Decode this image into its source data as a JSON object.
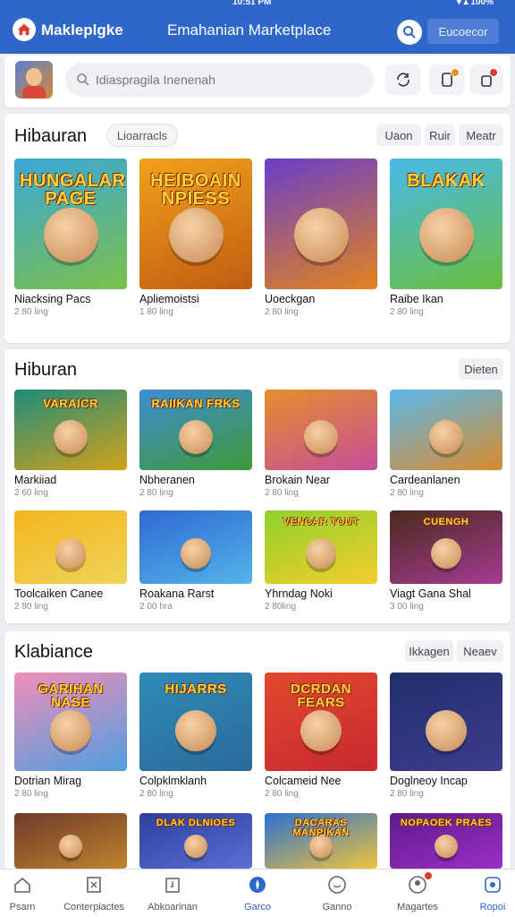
{
  "statusbar": {
    "time": "10:51 PM",
    "status": "▾ ▴ 100%"
  },
  "header": {
    "brand": "Makleplgke",
    "title": "Emahanian Marketplace",
    "action_label": "Eucoecor"
  },
  "search": {
    "placeholder": "Idiaspragila Inenenah"
  },
  "sections": [
    {
      "title": "Hibauran",
      "chip": "Lioarracls",
      "pills": [
        "Uaon",
        "Ruir",
        "Meatr"
      ],
      "items": [
        {
          "name": "Niacksing Pacs",
          "meta": "2 80 ling",
          "art": "HUNGALAR PAGE",
          "bg": [
            "#3aa7d8",
            "#7cc04a"
          ],
          "icon": "game-art"
        },
        {
          "name": "Apliemoistsi",
          "meta": "1 80 ling",
          "art": "HEIBOAIN NPIESS",
          "bg": [
            "#f0a21a",
            "#c25b12"
          ],
          "icon": "game-art"
        },
        {
          "name": "Uoeckgan",
          "meta": "2 80 ling",
          "art": "",
          "bg": [
            "#6a3ec9",
            "#e2831f"
          ],
          "icon": "game-art"
        },
        {
          "name": "Raibe Ikan",
          "meta": "2 80 ling",
          "art": "BLAKAK",
          "bg": [
            "#47b9e8",
            "#6bbf3e"
          ],
          "icon": "game-art"
        }
      ]
    },
    {
      "title": "Hiburan",
      "pills": [
        "Dieten"
      ],
      "items": [
        {
          "name": "Markiiad",
          "meta": "2 60 ling",
          "art": "VARAICR",
          "bg": [
            "#1e8c7a",
            "#d3a21c"
          ],
          "icon": "game-art"
        },
        {
          "name": "Nbheranen",
          "meta": "2 80 ling",
          "art": "RAIIKAN FRKS",
          "bg": [
            "#3d8bd5",
            "#3f9a36"
          ],
          "icon": "game-art"
        },
        {
          "name": "Brokain Near",
          "meta": "2 80 ling",
          "art": "",
          "bg": [
            "#e48f2a",
            "#c64e9a"
          ],
          "icon": "game-art"
        },
        {
          "name": "Cardeanlanen",
          "meta": "2 80 ling",
          "art": "",
          "bg": [
            "#58b8ec",
            "#d98b2c"
          ],
          "icon": "game-art"
        },
        {
          "name": "Toolcaiken Canee",
          "meta": "2 80 ling",
          "art": "",
          "bg": [
            "#f2b51c",
            "#f0d45a"
          ],
          "icon": "game-art"
        },
        {
          "name": "Roakana Rarst",
          "meta": "2 00 hra",
          "art": "",
          "bg": [
            "#2f6ad2",
            "#53b4e8"
          ],
          "icon": "game-art"
        },
        {
          "name": "Yhrndag Noki",
          "meta": "2 80ling",
          "art": "VENCAR TOUT",
          "bg": [
            "#8fd12c",
            "#f4cd2d"
          ],
          "icon": "game-art"
        },
        {
          "name": "Viagt Gana Shal",
          "meta": "3 00 ling",
          "art": "CUENGH",
          "bg": [
            "#4a2a1c",
            "#a63b94"
          ],
          "icon": "game-art"
        }
      ]
    },
    {
      "title": "Klabiance",
      "pills": [
        "Ikkagen",
        "Neaev"
      ],
      "items": [
        {
          "name": "Dotrian Mirag",
          "meta": "2 80 ling",
          "art": "GARIHAN NASE",
          "bg": [
            "#f08eb8",
            "#4f9ee0"
          ],
          "icon": "game-art"
        },
        {
          "name": "Colpklmklanh",
          "meta": "2 80 ling",
          "art": "HIJARRS",
          "bg": [
            "#2f8bb7",
            "#2a6a9c"
          ],
          "icon": "game-art"
        },
        {
          "name": "Colcameid Nee",
          "meta": "2 80 ling",
          "art": "DCRDAN FEARS",
          "bg": [
            "#e0492e",
            "#c9282f"
          ],
          "icon": "game-art"
        },
        {
          "name": "Doglneoy Incap",
          "meta": "2 80 ling",
          "art": "",
          "bg": [
            "#1f2f6b",
            "#3f3c8e"
          ],
          "icon": "game-art"
        },
        {
          "name": "",
          "meta": "",
          "art": "",
          "bg": [
            "#6d3a2a",
            "#c0832e"
          ],
          "icon": "game-art"
        },
        {
          "name": "",
          "meta": "",
          "art": "DLAK DLNIOES",
          "bg": [
            "#2c3f9b",
            "#5a6fd6"
          ],
          "icon": "game-art"
        },
        {
          "name": "",
          "meta": "",
          "art": "DACARAS MANPIKAN",
          "bg": [
            "#2b6fd2",
            "#f0c43a"
          ],
          "icon": "game-art"
        },
        {
          "name": "",
          "meta": "",
          "art": "NOPAOEK PRAES",
          "bg": [
            "#5e1b8c",
            "#9b2fc5"
          ],
          "icon": "game-art"
        }
      ]
    }
  ],
  "bottom_nav": [
    {
      "label": "Psarn",
      "icon": "home-icon"
    },
    {
      "label": "Conterpiactes",
      "icon": "document-icon"
    },
    {
      "label": "Abkoarinan",
      "icon": "calendar-icon"
    },
    {
      "label": "Garco",
      "icon": "compass-icon",
      "active": true
    },
    {
      "label": "Ganno",
      "icon": "chat-icon"
    },
    {
      "label": "Magartes",
      "icon": "profile-icon",
      "badge": true
    },
    {
      "label": "Ropoi",
      "icon": "settings-icon"
    }
  ],
  "colors": {
    "primary": "#2f66c9",
    "badge": "#e23b2e",
    "background": "#eceef2"
  }
}
